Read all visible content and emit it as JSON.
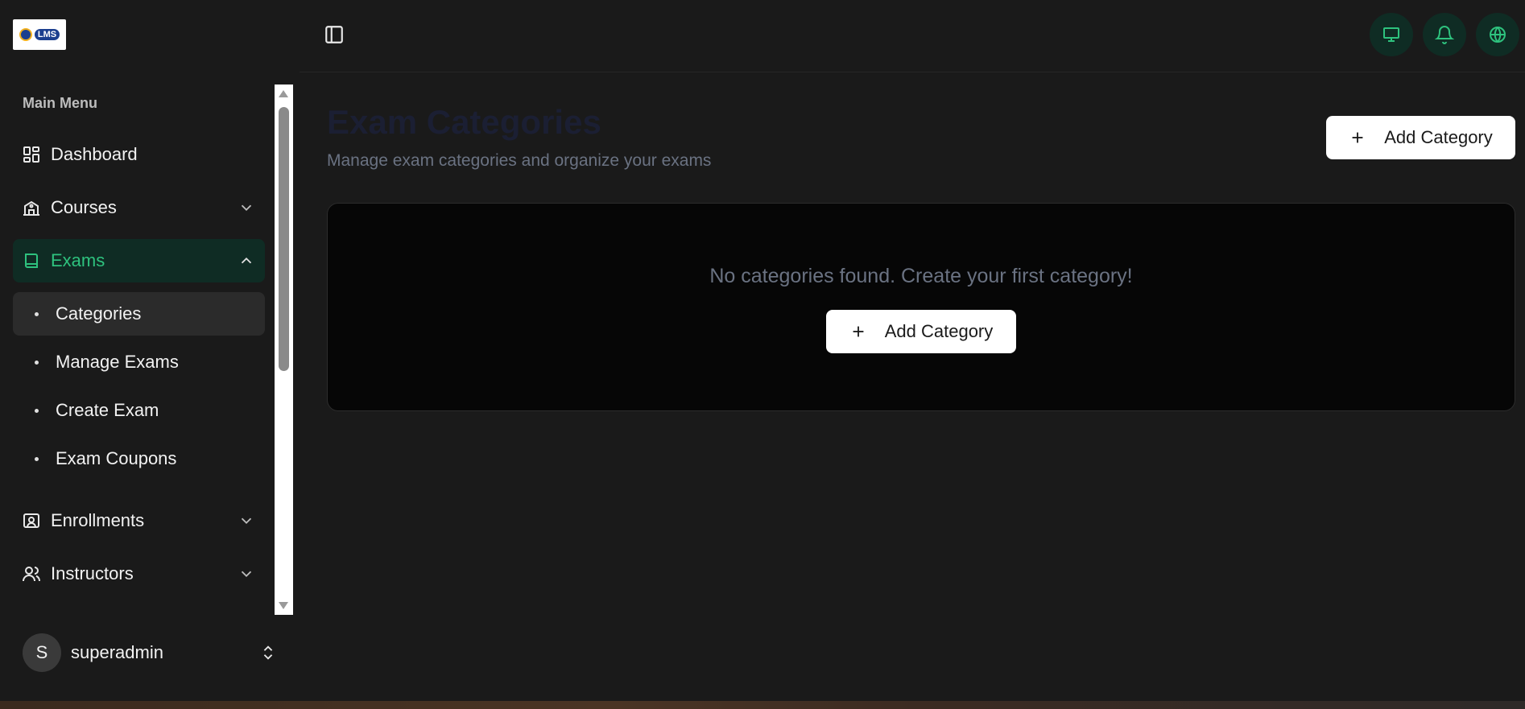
{
  "logo": {
    "text": "LMS"
  },
  "sidebar": {
    "heading": "Main Menu",
    "items": [
      {
        "label": "Dashboard",
        "icon": "grid-icon"
      },
      {
        "label": "Courses",
        "icon": "school-icon"
      },
      {
        "label": "Exams",
        "icon": "book-icon"
      },
      {
        "label": "Enrollments",
        "icon": "id-card-icon"
      },
      {
        "label": "Instructors",
        "icon": "users-icon"
      }
    ],
    "exam_subitems": [
      {
        "label": "Categories"
      },
      {
        "label": "Manage Exams"
      },
      {
        "label": "Create Exam"
      },
      {
        "label": "Exam Coupons"
      }
    ],
    "user": {
      "initial": "S",
      "name": "superadmin"
    }
  },
  "topbar": {
    "icons": [
      "monitor-icon",
      "bell-icon",
      "globe-icon"
    ]
  },
  "main": {
    "title": "Exam Categories",
    "subtitle": "Manage exam categories and organize your exams",
    "add_button_label": "Add Category",
    "empty_message": "No categories found. Create your first category!",
    "empty_button_label": "Add Category"
  },
  "colors": {
    "accent": "#2ec27e",
    "active_bg": "#0f2c24",
    "background": "#1a1a1a",
    "card_bg": "#060606"
  }
}
